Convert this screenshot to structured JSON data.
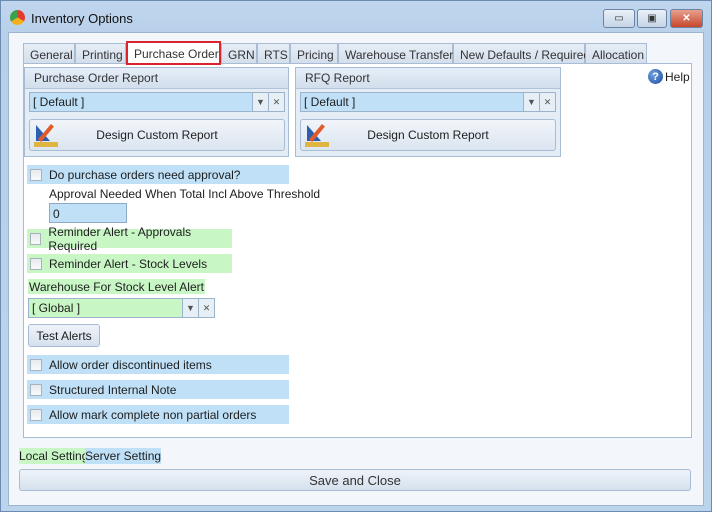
{
  "window": {
    "title": "Inventory Options",
    "minimize": "▭",
    "maximize": "▣",
    "close": "✕"
  },
  "tabs": [
    {
      "label": "General"
    },
    {
      "label": "Printing"
    },
    {
      "label": "Purchase Order",
      "active": true
    },
    {
      "label": "GRN"
    },
    {
      "label": "RTS"
    },
    {
      "label": "Pricing"
    },
    {
      "label": "Warehouse Transfer"
    },
    {
      "label": "New Defaults / Required"
    },
    {
      "label": "Allocation"
    }
  ],
  "help": "Help",
  "po_report": {
    "title": "Purchase Order Report",
    "value": "[ Default ]",
    "design_button": "Design Custom Report"
  },
  "rfq_report": {
    "title": "RFQ Report",
    "value": "[ Default ]",
    "design_button": "Design Custom Report"
  },
  "approval": {
    "label": "Do purchase orders need approval?",
    "checked": false,
    "threshold_label": "Approval Needed When Total Incl Above Threshold",
    "threshold_value": "0"
  },
  "reminder_approvals": {
    "label": "Reminder Alert - Approvals Required",
    "checked": false
  },
  "reminder_stock": {
    "label": "Reminder Alert - Stock Levels",
    "checked": false
  },
  "warehouse": {
    "label": "Warehouse For Stock Level Alert",
    "value": "[ Global ]"
  },
  "test_alerts": "Test Alerts",
  "discontinued": {
    "label": "Allow order discontinued items",
    "checked": false
  },
  "structured_note": {
    "label": "Structured Internal Note",
    "checked": false
  },
  "mark_complete": {
    "label": "Allow mark complete non partial orders",
    "checked": false
  },
  "legend": {
    "local": "Local Setting",
    "server": "Server Setting"
  },
  "save": "Save and Close",
  "colors": {
    "local": "#c8f7c5",
    "server": "#bfe0f7",
    "active_tab_border": "#d9232d"
  }
}
